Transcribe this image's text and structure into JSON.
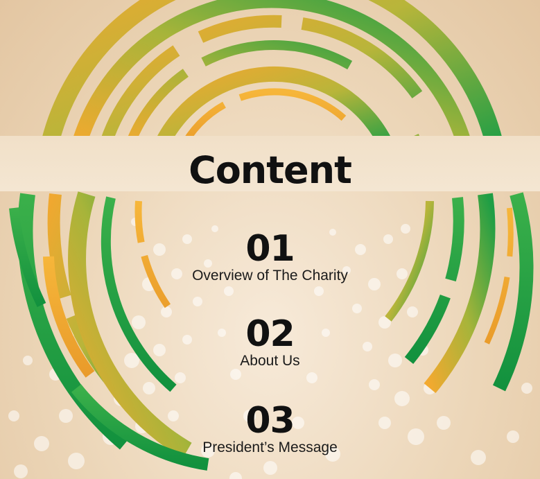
{
  "title": "Content",
  "colors": {
    "background": "#ecd6b8",
    "green": "#1f9e45",
    "orange": "#f0a830",
    "olive": "#a8b43a",
    "text": "#111111"
  },
  "toc": [
    {
      "number": "01",
      "label": "Overview of The Charity"
    },
    {
      "number": "02",
      "label": "About Us"
    },
    {
      "number": "03",
      "label": "President’s Message"
    }
  ]
}
